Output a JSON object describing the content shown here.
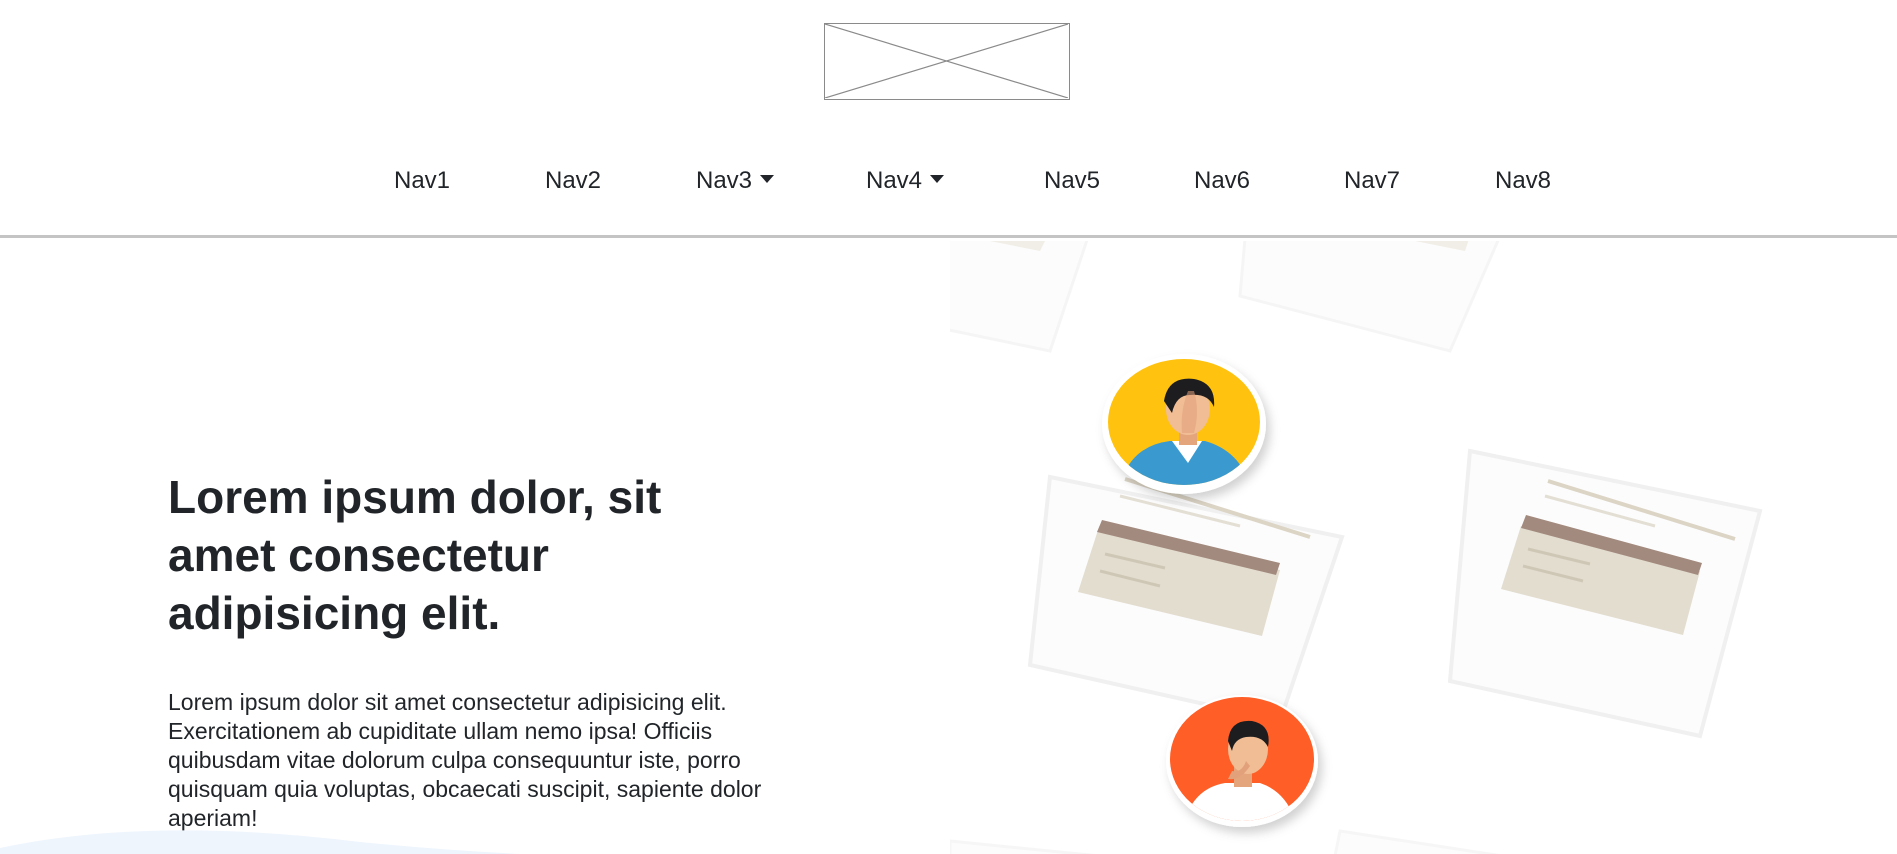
{
  "header": {
    "logo_icon": "image-placeholder-icon",
    "nav": [
      {
        "label": "Nav1",
        "dropdown": false
      },
      {
        "label": "Nav2",
        "dropdown": false
      },
      {
        "label": "Nav3",
        "dropdown": true
      },
      {
        "label": "Nav4",
        "dropdown": true
      },
      {
        "label": "Nav5",
        "dropdown": false
      },
      {
        "label": "Nav6",
        "dropdown": false
      },
      {
        "label": "Nav7",
        "dropdown": false
      },
      {
        "label": "Nav8",
        "dropdown": false
      }
    ]
  },
  "hero": {
    "title": "Lorem ipsum dolor, sit amet consectetur adipisicing elit.",
    "body": "Lorem ipsum dolor sit amet consectetur adipisicing elit. Exercitationem ab cupiditate ullam nemo ipsa! Officiis quibusdam vitae dolorum culpa consequuntur iste, porro quisquam quia voluptas, obcaecati suscipit, sapiente dolor aperiam!",
    "illustration_icons": [
      "profile-card-icon",
      "avatar-man-icon",
      "avatar-thinking-man-icon"
    ]
  },
  "colors": {
    "text": "#212529",
    "header_border": "#c4c4c4",
    "avatar_yellow": "#FFC20E",
    "avatar_orange": "#FF5E26",
    "card_banner": "#A38A7E",
    "card_panel": "#DCD5C6"
  }
}
